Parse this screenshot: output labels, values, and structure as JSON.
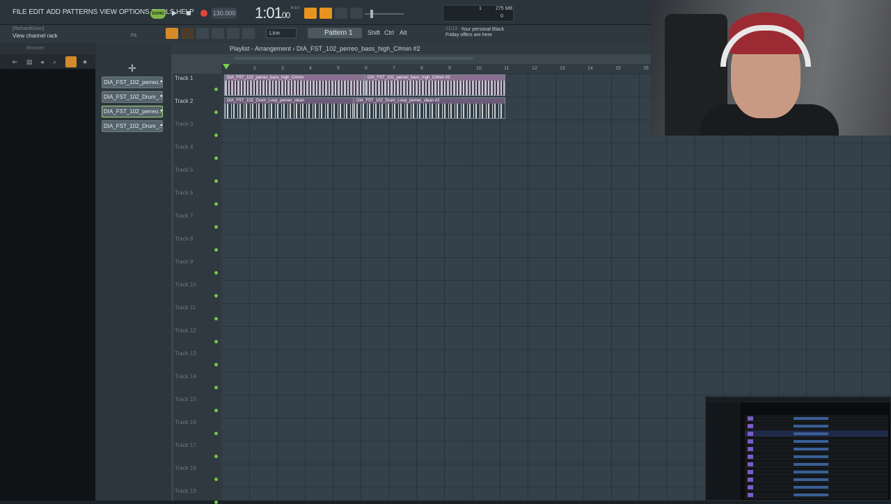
{
  "menu": [
    "FILE",
    "EDIT",
    "ADD",
    "PATTERNS",
    "VIEW",
    "OPTIONS",
    "TOOLS",
    "HELP"
  ],
  "transport": {
    "mode_label": "SONG",
    "tempo": "130.000",
    "time_main": "1:01",
    "time_ticks": "00",
    "time_mode": "B:S:T"
  },
  "cpu": {
    "polyphony": "1",
    "memory": "275 MB",
    "zero": "0"
  },
  "hint": {
    "user": "[RichardGiron]",
    "text": "View channel rack",
    "key": "F6"
  },
  "toolbar": {
    "snap": "Line",
    "pattern": "Pattern 1",
    "shift": "Shift",
    "ctrl": "Ctrl",
    "alt": "Alt"
  },
  "news": {
    "date": "11/13",
    "line1": "Your personal Black",
    "line2": "Friday offers are here"
  },
  "browser": {
    "title": "Browser"
  },
  "channel_rack": {
    "items": [
      {
        "label": "DIA_FST_102_perreo..."
      },
      {
        "label": "DIA_FST_102_Drum_..."
      },
      {
        "label": "DIA_FST_102_perreo..."
      },
      {
        "label": "DIA_FST_102_Drum_..."
      }
    ]
  },
  "playlist": {
    "title": "Playlist - Arrangement",
    "clip_name": "DIA_FST_102_perreo_bass_high_C#min #2",
    "bars": [
      "2",
      "3",
      "4",
      "5",
      "6",
      "7",
      "8",
      "9",
      "10",
      "11",
      "12",
      "13",
      "14",
      "15",
      "16"
    ],
    "tracks": [
      "Track 1",
      "Track 2",
      "Track 3",
      "Track 4",
      "Track 5",
      "Track 6",
      "Track 7",
      "Track 8",
      "Track 9",
      "Track 10",
      "Track 11",
      "Track 12",
      "Track 13",
      "Track 14",
      "Track 15",
      "Track 16",
      "Track 17",
      "Track 18",
      "Track 19"
    ],
    "clips": [
      {
        "label": "DIA_FST_102_perreo_bass_high_C#min",
        "track": 1,
        "type": "bass"
      },
      {
        "label": "DIA_FST_102_perreo_bass_high_C#min #2",
        "track": 1,
        "type": "bass"
      },
      {
        "label": "DIA_FST_102_Drum_Loop_perreo_clean",
        "track": 2,
        "type": "drum"
      },
      {
        "label": "DIA_FST_102_Drum_Loop_perreo_clean #2",
        "track": 2,
        "type": "drum"
      }
    ]
  }
}
